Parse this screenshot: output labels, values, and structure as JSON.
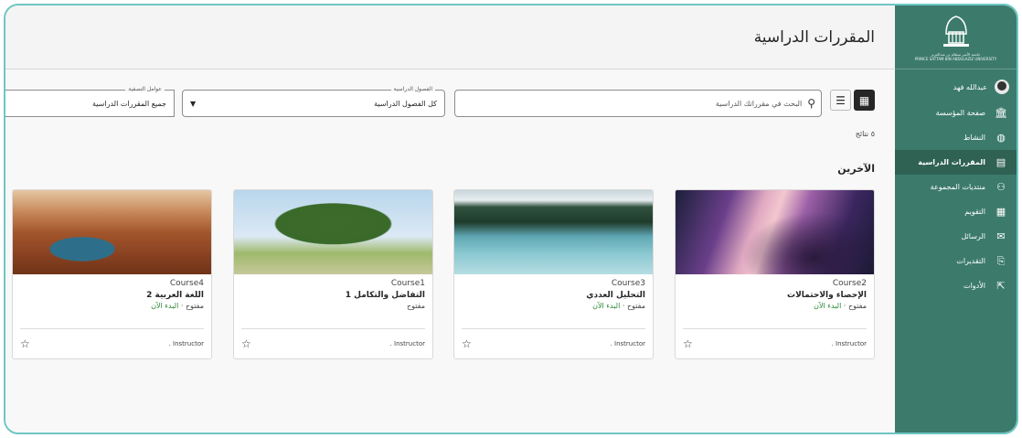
{
  "page": {
    "title": "المقررات الدراسية"
  },
  "sidebar": {
    "logo_text": "جامعة الأمير سطام بن عبدالعزيز\nPRINCE SATTAM BIN ABDULAZIZ UNIVERSITY",
    "user_name": "عبدالله فهد",
    "items": [
      {
        "label": "صفحة المؤسسة",
        "icon": "institution-icon",
        "glyph": "🏛"
      },
      {
        "label": "النشاط",
        "icon": "globe-icon",
        "glyph": "◍"
      },
      {
        "label": "المقررات الدراسية",
        "icon": "courses-icon",
        "glyph": "▤"
      },
      {
        "label": "منتديات المجموعة",
        "icon": "groups-icon",
        "glyph": "⚇"
      },
      {
        "label": "التقويم",
        "icon": "calendar-icon",
        "glyph": "▦"
      },
      {
        "label": "الرسائل",
        "icon": "mail-icon",
        "glyph": "✉"
      },
      {
        "label": "التقديرات",
        "icon": "grades-icon",
        "glyph": "⎘"
      },
      {
        "label": "الأدوات",
        "icon": "tools-icon",
        "glyph": "⇱"
      }
    ],
    "active_index": 2
  },
  "toolbar": {
    "search_placeholder": "البحث في مقرراتك الدراسية",
    "term_legend": "الفصول الدراسية",
    "term_value": "كل الفصول الدراسية",
    "filter_legend": "عوامل التصفية",
    "filter_value": "جميع المقررات الدراسية"
  },
  "results_text": "٥ نتائج",
  "section_title": "الآخرين",
  "courses": [
    {
      "code": "Course2",
      "name": "الإحصاء والاحتمالات",
      "status": "مفتوح",
      "action": "البدء الآن",
      "instructor": "Instructor .",
      "thumb": "canyon-slot"
    },
    {
      "code": "Course3",
      "name": "التحليل العددي",
      "status": "مفتوح",
      "action": "البدء الآن",
      "instructor": "Instructor .",
      "thumb": "lake-forest"
    },
    {
      "code": "Course1",
      "name": "التفاضل والتكامل 1",
      "status": "مفتوح",
      "action": "",
      "instructor": "Instructor .",
      "thumb": "tree"
    },
    {
      "code": "Course4",
      "name": "اللغة العربية 2",
      "status": "مفتوح",
      "action": "البدء الآن",
      "instructor": "Instructor .",
      "thumb": "horseshoe-bend"
    }
  ],
  "colors": {
    "sidebar": "#3c7b6b",
    "sidebar_active": "#2f6253",
    "accent_green": "#2e8b3a",
    "frame": "#6ec6c3"
  }
}
